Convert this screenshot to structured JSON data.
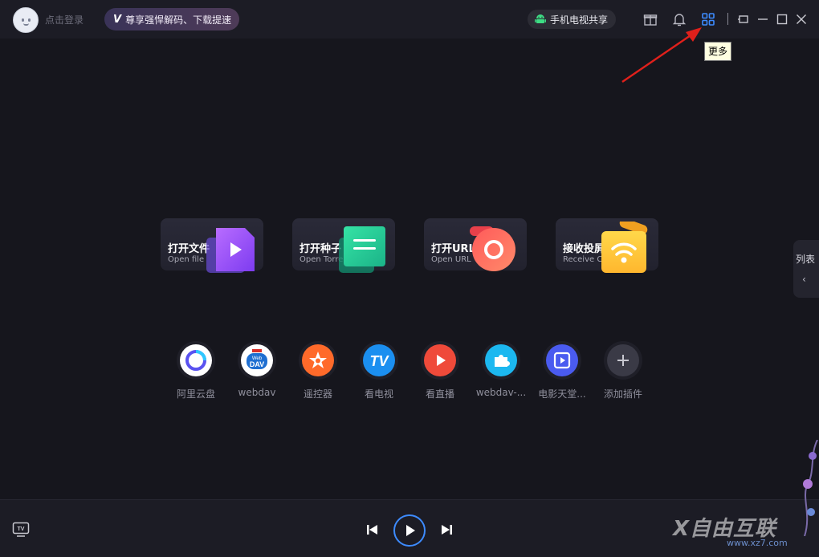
{
  "header": {
    "login_text": "点击登录",
    "vip_banner": "尊享强悍解码、下载提速",
    "share_button": "手机电视共享",
    "tooltip_more": "更多",
    "icons": [
      "gift-icon",
      "bell-icon",
      "grid-more-icon",
      "mini-mode-icon",
      "minimize-icon",
      "maximize-icon",
      "close-icon"
    ]
  },
  "cards": [
    {
      "title": "打开文件",
      "subtitle": "Open file"
    },
    {
      "title": "打开种子",
      "subtitle": "Open Torrent"
    },
    {
      "title": "打开URL",
      "subtitle": "Open URL"
    },
    {
      "title": "接收投屏",
      "subtitle": "Receive Cast"
    }
  ],
  "plugins": [
    {
      "label": "阿里云盘",
      "color": "#ffffff"
    },
    {
      "label": "webdav",
      "color": "#ffffff"
    },
    {
      "label": "遥控器",
      "color": "#ff6a2a"
    },
    {
      "label": "看电视",
      "color": "#1b8ff0"
    },
    {
      "label": "看直播",
      "color": "#ef4a3a"
    },
    {
      "label": "webdav-...",
      "color": "#1cb8f0"
    },
    {
      "label": "电影天堂...",
      "color": "#4a5bf0"
    },
    {
      "label": "添加插件",
      "color": "#3a3a46"
    }
  ],
  "plugin_icon_text": {
    "webdav_small": "Web",
    "webdav_big": "DAV",
    "tv": "TV"
  },
  "sidebar_tab": {
    "label": "列表",
    "chevron": "‹"
  },
  "watermark": {
    "text": "X自由互联",
    "url": "www.xz7.com"
  },
  "colors": {
    "accent": "#3d8bff",
    "arrow": "#e0201b",
    "background": "#16161d"
  }
}
